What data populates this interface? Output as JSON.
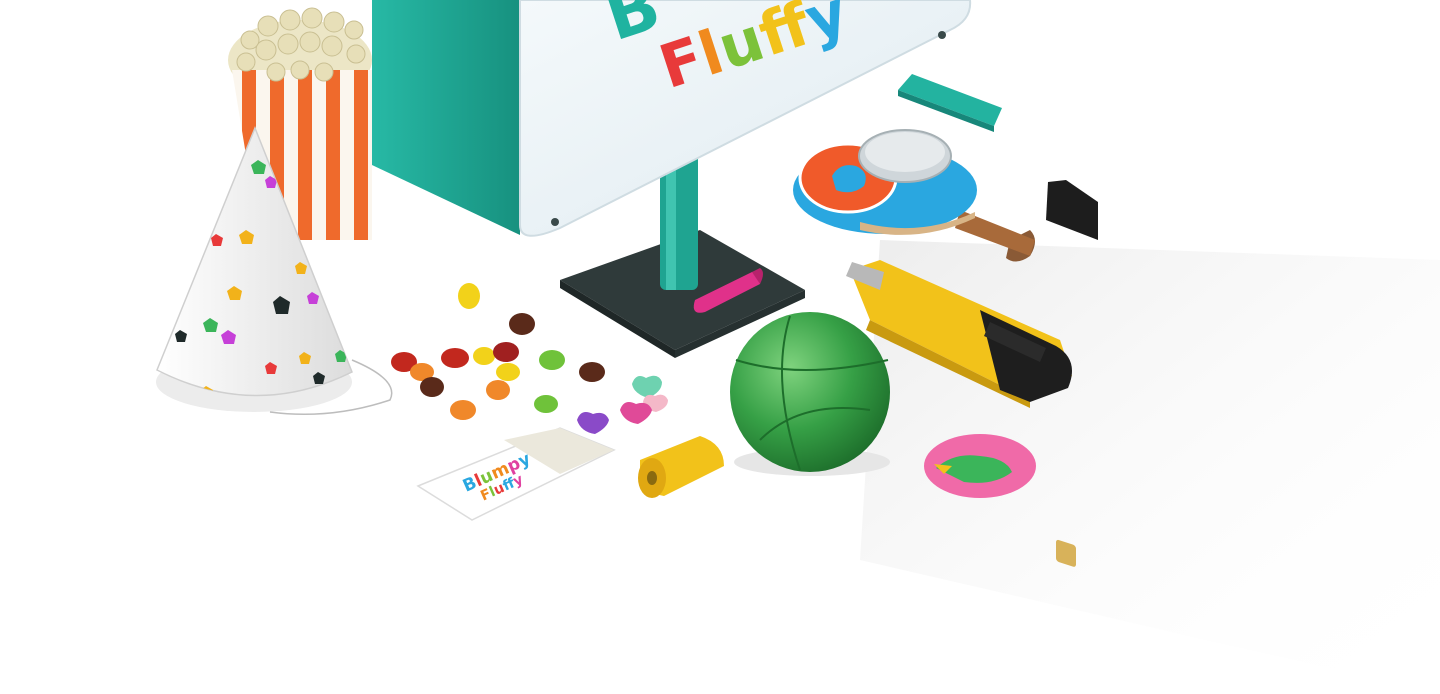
{
  "colors": {
    "background": "#ffffff",
    "teal": "#1fb3a0",
    "sign_face": "#e9f2f6",
    "popcorn_stripe": "#ef6a2c",
    "ball_green": "#3aa64a",
    "cutter_yellow": "#f2c21a",
    "badge_pink": "#f16aa8"
  },
  "sign": {
    "partial_letter": "B",
    "word": "Fluffy",
    "letter_colors": [
      "#e83a3a",
      "#f08a1e",
      "#7cc23a",
      "#f2c21a",
      "#e83a3a",
      "#2aa7e0"
    ]
  },
  "ticket": {
    "line1": "Blumpy",
    "line2": "Fluffy",
    "line1_colors": [
      "#2aa7e0",
      "#e83a3a",
      "#7cc23a",
      "#f08a1e",
      "#e040a0",
      "#2aa7e0"
    ],
    "line2_colors": [
      "#f08a1e",
      "#7cc23a",
      "#e83a3a",
      "#2aa7e0",
      "#f2c21a",
      "#e040a0"
    ]
  },
  "icons": [
    "party-hat-icon",
    "popcorn-bucket-icon",
    "signboard-icon",
    "candy-icon",
    "ball-icon",
    "box-cutter-icon",
    "ping-pong-paddle-icon",
    "pin-badge-icon",
    "sim-card-icon",
    "pencil-sharpener-icon",
    "lipstick-icon",
    "eraser-icon",
    "ticket-icon"
  ]
}
